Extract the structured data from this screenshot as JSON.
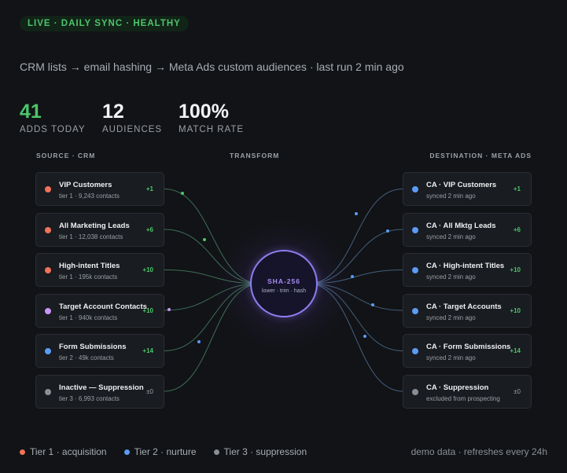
{
  "header": {
    "badge": "LIVE · DAILY SYNC · HEALTHY",
    "subtitle": "CRM lists → email hashing → Meta Ads custom audiences · last run 2 min ago"
  },
  "stats": [
    {
      "value": "41",
      "label": "ADDS TODAY"
    },
    {
      "value": "12",
      "label": "AUDIENCES"
    },
    {
      "value": "100%",
      "label": "MATCH RATE"
    }
  ],
  "columns": {
    "source": "SOURCE · CRM",
    "transform": "TRANSFORM",
    "destination": "DESTINATION · META ADS"
  },
  "colors": {
    "tier1": "#f0735a",
    "tier2": "#5b9bf5",
    "tier3": "#8a8f96",
    "target": "#c895f5",
    "green": "#4cc56a",
    "hub": "#8f7cf0"
  },
  "sources": [
    {
      "name": "VIP Customers",
      "meta": "tier 1 · 9,243 contacts",
      "delta": "+1",
      "tier": "tier1"
    },
    {
      "name": "All Marketing Leads",
      "meta": "tier 1 · 12,038 contacts",
      "delta": "+6",
      "tier": "tier1"
    },
    {
      "name": "High-intent Titles",
      "meta": "tier 1 · 195k contacts",
      "delta": "+10",
      "tier": "tier1"
    },
    {
      "name": "Target Account Contacts",
      "meta": "tier 1 · 940k contacts",
      "delta": "+10",
      "tier": "target"
    },
    {
      "name": "Form Submissions",
      "meta": "tier 2 · 49k contacts",
      "delta": "+14",
      "tier": "tier2"
    },
    {
      "name": "Inactive — Suppression",
      "meta": "tier 3 · 6,993 contacts",
      "delta": "±0",
      "tier": "tier3"
    }
  ],
  "destinations": [
    {
      "name": "CA · VIP Customers",
      "meta": "synced 2 min ago",
      "delta": "+1",
      "tier": "tier2"
    },
    {
      "name": "CA · All Mktg Leads",
      "meta": "synced 2 min ago",
      "delta": "+6",
      "tier": "tier2"
    },
    {
      "name": "CA · High-intent Titles",
      "meta": "synced 2 min ago",
      "delta": "+10",
      "tier": "tier2"
    },
    {
      "name": "CA · Target Accounts",
      "meta": "synced 2 min ago",
      "delta": "+10",
      "tier": "tier2"
    },
    {
      "name": "CA · Form Submissions",
      "meta": "synced 2 min ago",
      "delta": "+14",
      "tier": "tier2"
    },
    {
      "name": "CA · Suppression",
      "meta": "excluded from prospecting",
      "delta": "±0",
      "tier": "tier3"
    }
  ],
  "hub": {
    "algorithm": "SHA-256",
    "steps": "lower · trim · hash"
  },
  "legend": [
    {
      "label": "Tier 1 · acquisition",
      "tier": "tier1"
    },
    {
      "label": "Tier 2 · nurture",
      "tier": "tier2"
    },
    {
      "label": "Tier 3 · suppression",
      "tier": "tier3"
    }
  ],
  "footnote": "demo data · refreshes every 24h"
}
